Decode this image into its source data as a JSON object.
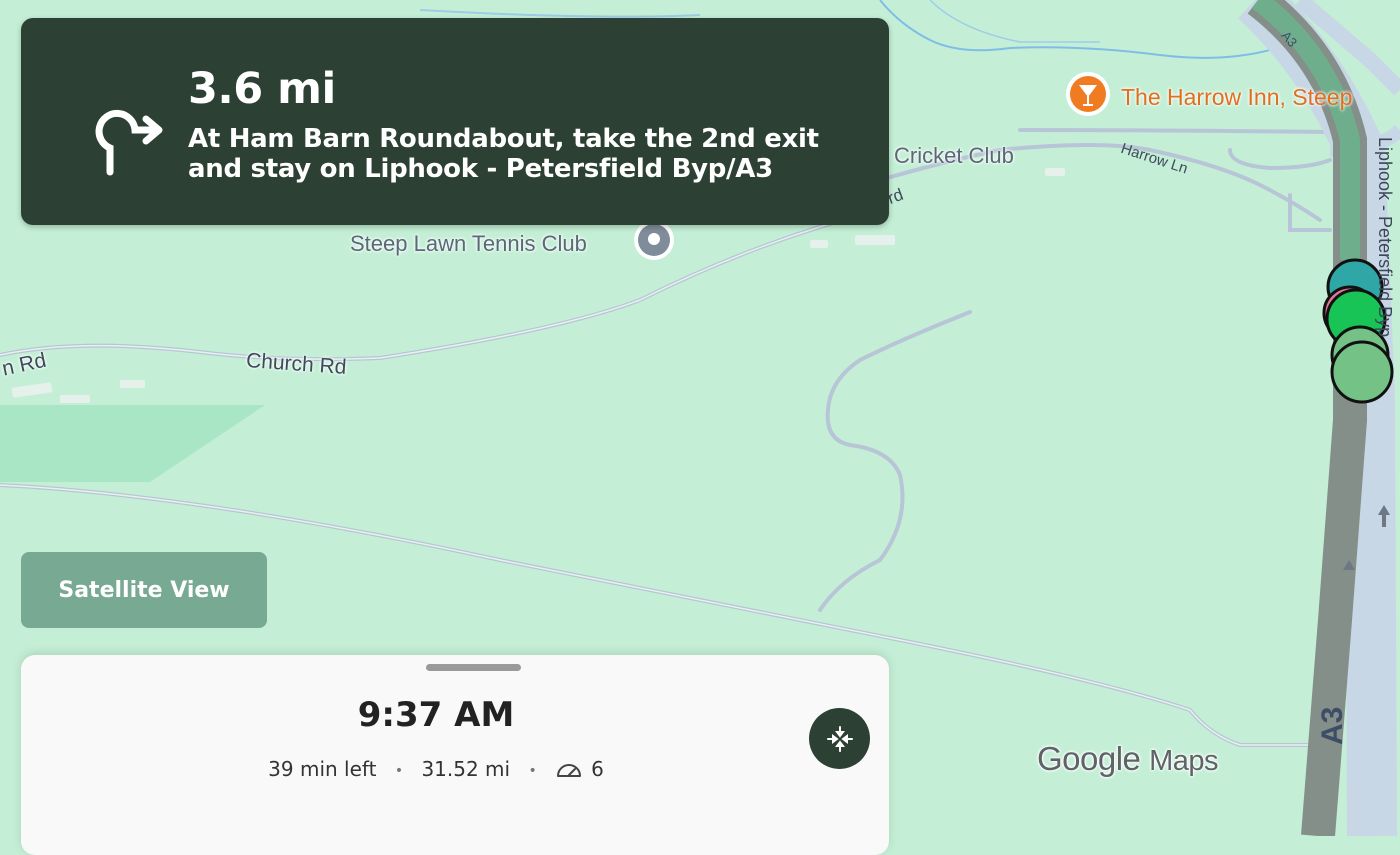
{
  "navigation": {
    "distance": "3.6 mi",
    "instruction_line1": "At Ham Barn Roundabout, take the 2nd exit",
    "instruction_line2": "and stay on Liphook - Petersfield Byp/A3",
    "maneuver_icon": "roundabout-2nd-exit-icon"
  },
  "map": {
    "labels": {
      "poi_pub": "The Harrow Inn, Steep",
      "poi_cricket": "Cricket Club",
      "poi_tennis": "Steep Lawn Tennis Club",
      "road_harrow_ln": "Harrow Ln",
      "road_church_rd": "Church Rd",
      "road_rd_left": "n Rd",
      "road_rd_top": "rd",
      "road_bypass": "Liphook - Petersfield Byp",
      "road_a3_big": "A3",
      "road_a3_small": "A3"
    },
    "colors": {
      "background": "#c4efd6",
      "route": "#858f89",
      "poi_pub": "#f07b21"
    }
  },
  "controls": {
    "satellite_label": "Satellite View"
  },
  "trip": {
    "eta": "9:37 AM",
    "time_left": "39 min left",
    "distance_left": "31.52 mi",
    "stops": "6",
    "stops_icon": "speedometer-icon",
    "recenter_icon": "recenter-arrows-icon"
  },
  "watermark": {
    "google": "Google",
    "maps": "Maps"
  }
}
